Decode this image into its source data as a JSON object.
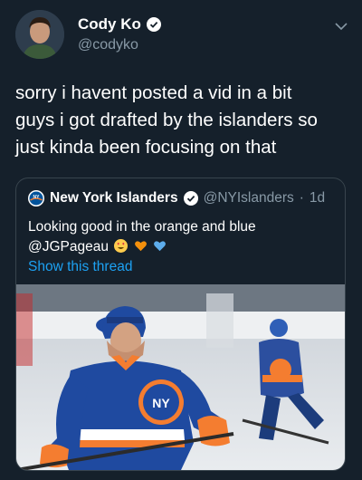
{
  "tweet": {
    "author_name": "Cody Ko",
    "author_handle": "@codyko",
    "text_lines": [
      "sorry i havent posted a vid in a bit",
      "guys i got drafted by the islanders so",
      "just kinda been focusing on that"
    ],
    "icons": {
      "verified": "verified-badge-icon",
      "menu": "chevron-down-icon"
    }
  },
  "quoted_tweet": {
    "author_name": "New York Islanders",
    "author_handle": "@NYIslanders",
    "separator": "·",
    "time": "1d",
    "text_line1": "Looking good in the orange and blue",
    "text_line2": "@JGPageau",
    "emojis": [
      "heart-eyes-emoji",
      "orange-heart-emoji",
      "blue-heart-emoji"
    ],
    "show_thread": "Show this thread",
    "photo": "hockey-player-photo"
  },
  "colors": {
    "background": "#15202b",
    "text": "#ffffff",
    "secondary_text": "#8899a6",
    "link": "#1da1f2",
    "border": "#38444d",
    "islanders_blue": "#00539b",
    "islanders_orange": "#f47d30"
  }
}
